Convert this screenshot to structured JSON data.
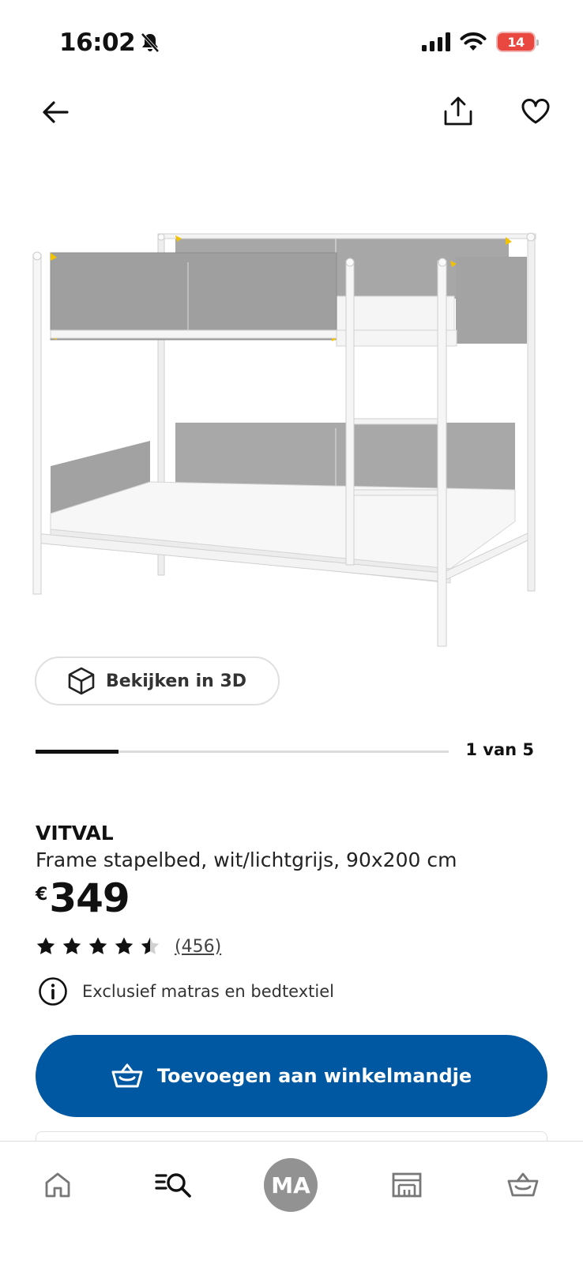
{
  "status_bar": {
    "time": "16:02",
    "battery": "14"
  },
  "product": {
    "name": "VITVAL",
    "description": "Frame stapelbed, wit/lichtgrijs, 90x200 cm",
    "currency": "€",
    "price": "349",
    "rating": 4.5,
    "rating_max": 5,
    "review_count": "(456)",
    "info_note": "Exclusief matras en bedtextiel"
  },
  "gallery": {
    "view_3d_label": "Bekijken in 3D",
    "counter": "1 van 5",
    "current_image": 1,
    "total_images": 5
  },
  "actions": {
    "add_to_cart_label": "Toevoegen aan winkelmandje"
  },
  "tab_bar": {
    "avatar_initials": "MA",
    "tabs": [
      "home-icon",
      "search-icon",
      "profile-avatar",
      "store-icon",
      "basket-icon"
    ]
  },
  "colors": {
    "primary": "#0058a3",
    "avatar_bg": "#929292",
    "battery_low": "#e8483f"
  }
}
